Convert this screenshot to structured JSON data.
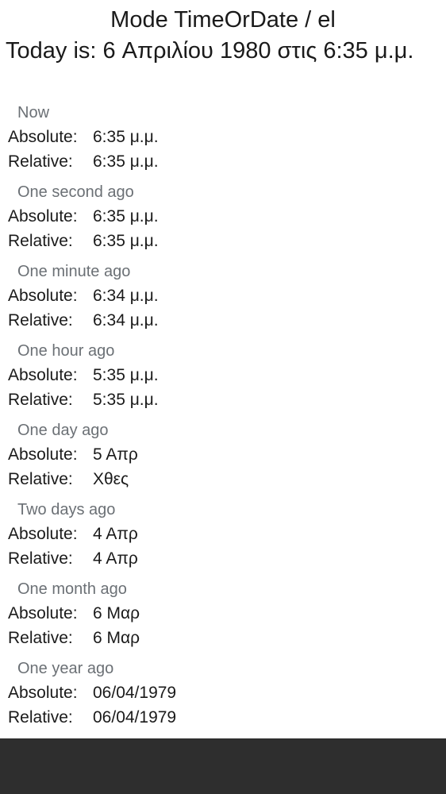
{
  "title": "Mode TimeOrDate / el",
  "today_text": "Today is: 6 Απριλίου 1980 στις 6:35 μ.μ.",
  "labels": {
    "absolute": "Absolute:",
    "relative": "Relative:"
  },
  "sections": [
    {
      "header": "Now",
      "absolute": "6:35 μ.μ.",
      "relative": "6:35 μ.μ."
    },
    {
      "header": "One second ago",
      "absolute": "6:35 μ.μ.",
      "relative": "6:35 μ.μ."
    },
    {
      "header": "One minute ago",
      "absolute": "6:34 μ.μ.",
      "relative": "6:34 μ.μ."
    },
    {
      "header": "One hour ago",
      "absolute": "5:35 μ.μ.",
      "relative": "5:35 μ.μ."
    },
    {
      "header": "One day ago",
      "absolute": "5 Απρ",
      "relative": "Χθες"
    },
    {
      "header": "Two days ago",
      "absolute": "4 Απρ",
      "relative": "4 Απρ"
    },
    {
      "header": "One month ago",
      "absolute": "6 Μαρ",
      "relative": "6 Μαρ"
    },
    {
      "header": "One year ago",
      "absolute": "06/04/1979",
      "relative": "06/04/1979"
    }
  ],
  "colors": {
    "text": "#1a1a1a",
    "section_header": "#6b7075",
    "nav_bar": "#2e2e2e",
    "background": "#ffffff"
  }
}
